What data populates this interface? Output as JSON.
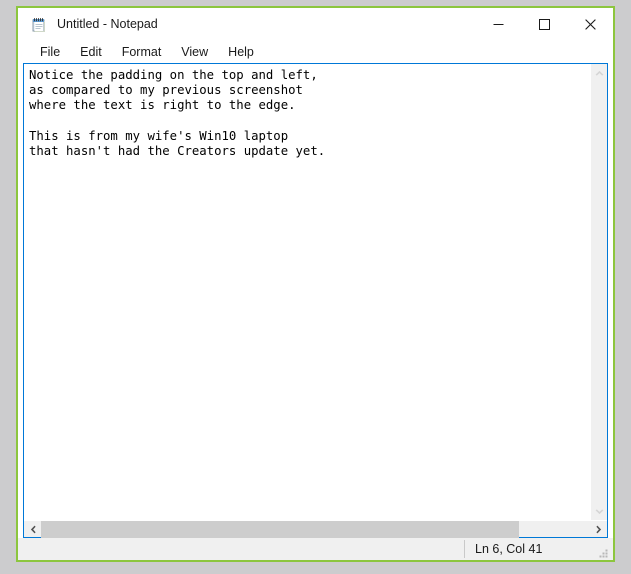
{
  "window": {
    "title": "Untitled - Notepad",
    "icon": "notepad-icon",
    "border_color": "#8cc63e",
    "titlebar_bg": "#ffffff",
    "controls": [
      {
        "name": "minimize",
        "glyph": "minimize-icon"
      },
      {
        "name": "maximize",
        "glyph": "maximize-icon"
      },
      {
        "name": "close",
        "glyph": "close-icon"
      }
    ]
  },
  "menu": {
    "items": [
      {
        "label": "File"
      },
      {
        "label": "Edit"
      },
      {
        "label": "Format"
      },
      {
        "label": "View"
      },
      {
        "label": "Help"
      }
    ]
  },
  "editor": {
    "border_color": "#0078d7",
    "background": "#ffffff",
    "text": "Notice the padding on the top and left,\nas compared to my previous screenshot\nwhere the text is right to the edge.\n\nThis is from my wife's Win10 laptop\nthat hasn't had the Creators update yet.",
    "lines": [
      "Notice the padding on the top and left,",
      "as compared to my previous screenshot",
      "where the text is right to the edge.",
      "",
      "This is from my wife's Win10 laptop",
      "that hasn't had the Creators update yet."
    ]
  },
  "scrollbars": {
    "vertical": {
      "up_arrow": "chevron-up-icon",
      "down_arrow": "chevron-down-icon",
      "track_color": "#f0f0f0",
      "arrow_color": "#d5d5d5"
    },
    "horizontal": {
      "left_arrow": "chevron-left-icon",
      "right_arrow": "chevron-right-icon",
      "track_color": "#f0f0f0",
      "thumb_color": "#cdcdcd",
      "arrow_color": "#505050"
    }
  },
  "status_bar": {
    "position_text": "Ln 6, Col 41",
    "background": "#f0f0f0",
    "grip": "resize-grip-icon"
  }
}
